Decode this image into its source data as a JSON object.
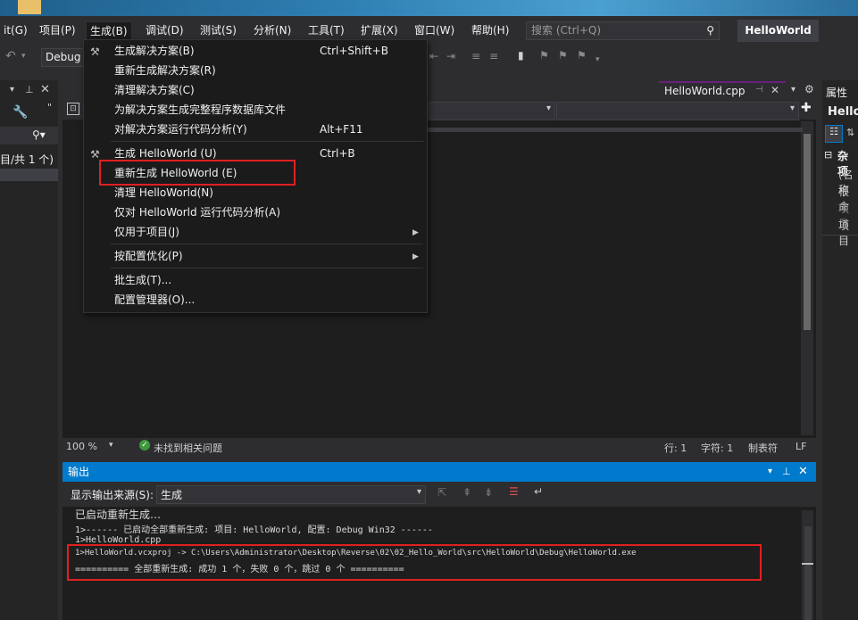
{
  "menubar": {
    "items": [
      "it(G)",
      "项目(P)",
      "生成(B)",
      "调试(D)",
      "测试(S)",
      "分析(N)",
      "工具(T)",
      "扩展(X)",
      "窗口(W)",
      "帮助(H)"
    ],
    "active": "生成(B)",
    "search_placeholder": "搜索 (Ctrl+Q)",
    "solution_name": "HelloWorld"
  },
  "toolbar": {
    "config": "Debug"
  },
  "left_panel": {
    "counter_text": "目/共 1 个)"
  },
  "build_menu": {
    "items": [
      {
        "label": "生成解决方案(B)",
        "shortcut": "Ctrl+Shift+B"
      },
      {
        "label": "重新生成解决方案(R)",
        "shortcut": ""
      },
      {
        "label": "清理解决方案(C)",
        "shortcut": ""
      },
      {
        "label": "为解决方案生成完整程序数据库文件",
        "shortcut": ""
      },
      {
        "label": "对解决方案运行代码分析(Y)",
        "shortcut": "Alt+F11"
      },
      {
        "label": "生成 HelloWorld (U)",
        "shortcut": "Ctrl+B"
      },
      {
        "label": "重新生成 HelloWorld (E)",
        "shortcut": ""
      },
      {
        "label": "清理 HelloWorld(N)",
        "shortcut": ""
      },
      {
        "label": "仅对 HelloWorld 运行代码分析(A)",
        "shortcut": ""
      },
      {
        "label": "仅用于项目(J)",
        "shortcut": ""
      },
      {
        "label": "按配置优化(P)",
        "shortcut": ""
      },
      {
        "label": "批生成(T)...",
        "shortcut": ""
      },
      {
        "label": "配置管理器(O)...",
        "shortcut": ""
      }
    ],
    "highlighted": "重新生成 HelloWorld (E)"
  },
  "editor": {
    "tab_label": "HelloWorld.cpp",
    "zoom": "100 %",
    "issues_text": "未找到相关问题",
    "line": "行: 1",
    "char": "字符: 1",
    "tabs_mode": "制表符",
    "line_ending": "LF"
  },
  "properties": {
    "title": "属性",
    "object": "Hello",
    "category": "杂项",
    "rows": [
      "(名称",
      "根命",
      "项目",
      "项目"
    ]
  },
  "output": {
    "title": "输出",
    "source_label": "显示输出来源(S):",
    "source_value": "生成",
    "lines": [
      "已启动重新生成…",
      "1>------ 已启动全部重新生成: 项目: HelloWorld, 配置: Debug Win32 ------",
      "1>HelloWorld.cpp",
      "1>HelloWorld.vcxproj -> C:\\Users\\Administrator\\Desktop\\Reverse\\02\\02_Hello_World\\src\\HelloWorld\\Debug\\HelloWorld.exe",
      "========== 全部重新生成: 成功 1 个，失败 0 个，跳过 0 个 =========="
    ]
  },
  "colors": {
    "accent": "#007acc",
    "highlight_box": "#e02020",
    "menu_bg": "#1b1b1c"
  }
}
